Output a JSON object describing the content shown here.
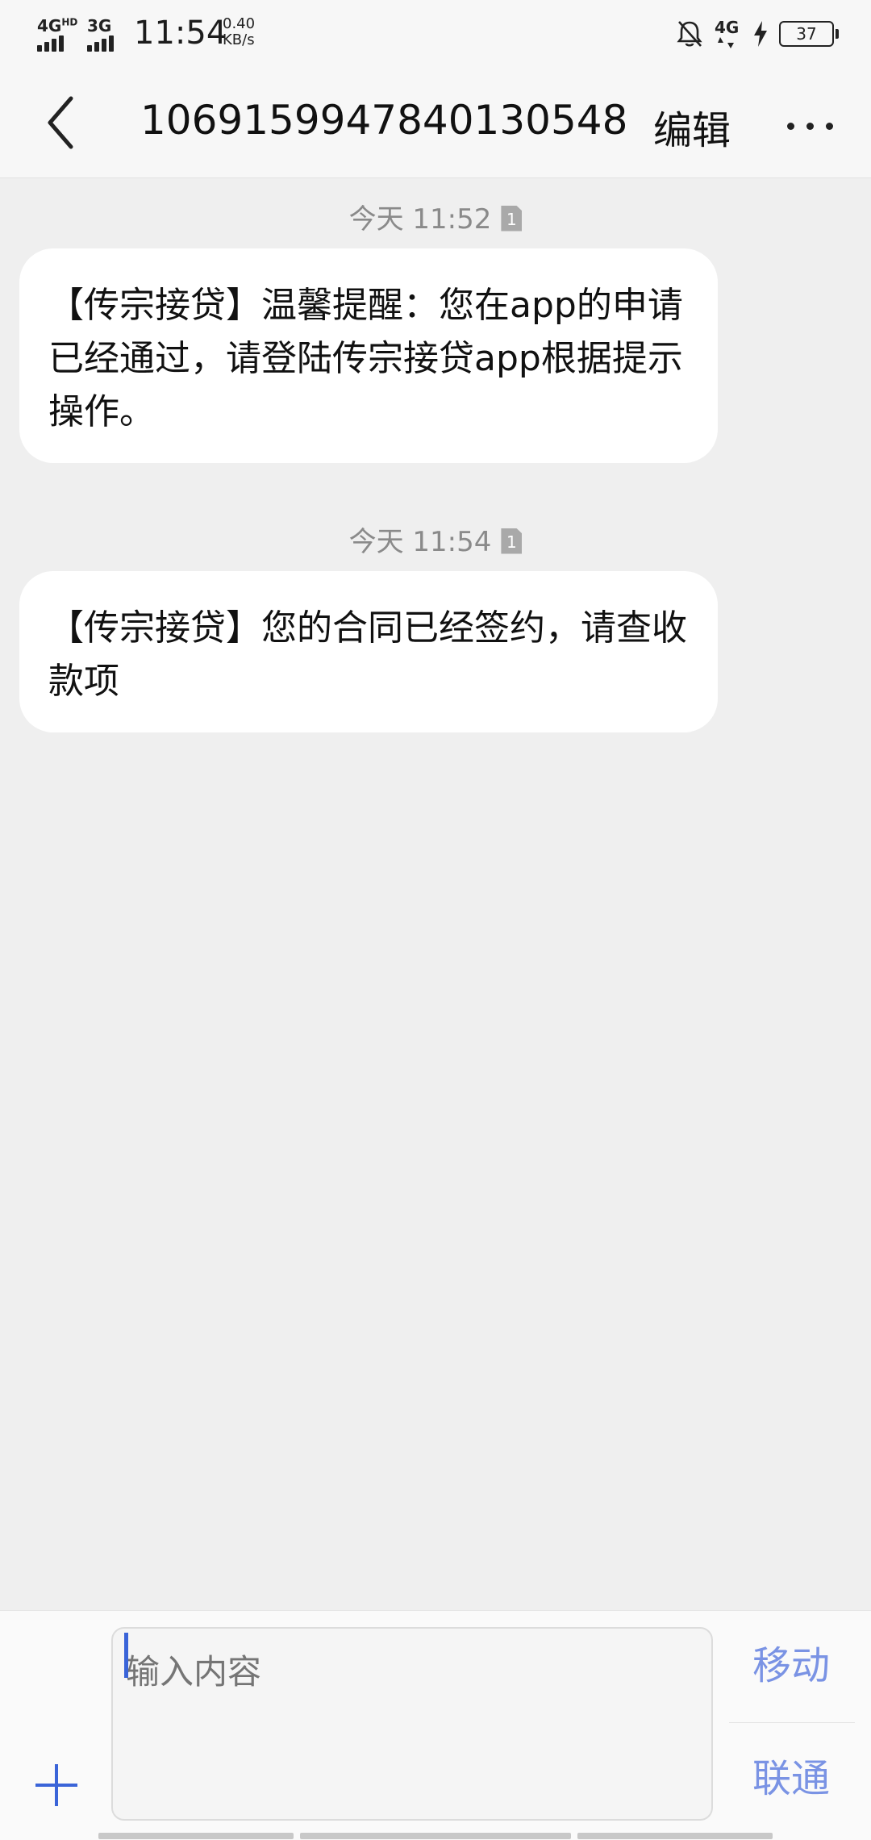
{
  "status_bar": {
    "network1": "4G",
    "network1_sup": "HD",
    "network2": "3G",
    "time": "11:54",
    "speed_value": "0.40",
    "speed_unit": "KB/s",
    "network3": "4G",
    "battery": "37",
    "icons": [
      "bell-off-icon",
      "signal-4g-icon",
      "charging-bolt-icon",
      "battery-icon"
    ]
  },
  "header": {
    "title": "1069159947840130548",
    "edit_label": "编辑",
    "back_icon": "chevron-left-icon",
    "more_icon": "more-dots-icon"
  },
  "messages": [
    {
      "timestamp": "今天 11:52",
      "sim": "1",
      "text": "【传宗接贷】温馨提醒：您在app的申请已经通过，请登陆传宗接贷app根据提示操作。"
    },
    {
      "timestamp": "今天 11:54",
      "sim": "1",
      "text": "【传宗接贷】您的合同已经签约，请查收款项"
    }
  ],
  "composer": {
    "placeholder": "输入内容",
    "value": "",
    "send_buttons": [
      "移动",
      "联通"
    ],
    "add_icon": "plus-icon"
  },
  "colors": {
    "accent": "#3a64d8",
    "send_text": "#7a93e4",
    "background": "#efefef",
    "bubble": "#ffffff"
  }
}
